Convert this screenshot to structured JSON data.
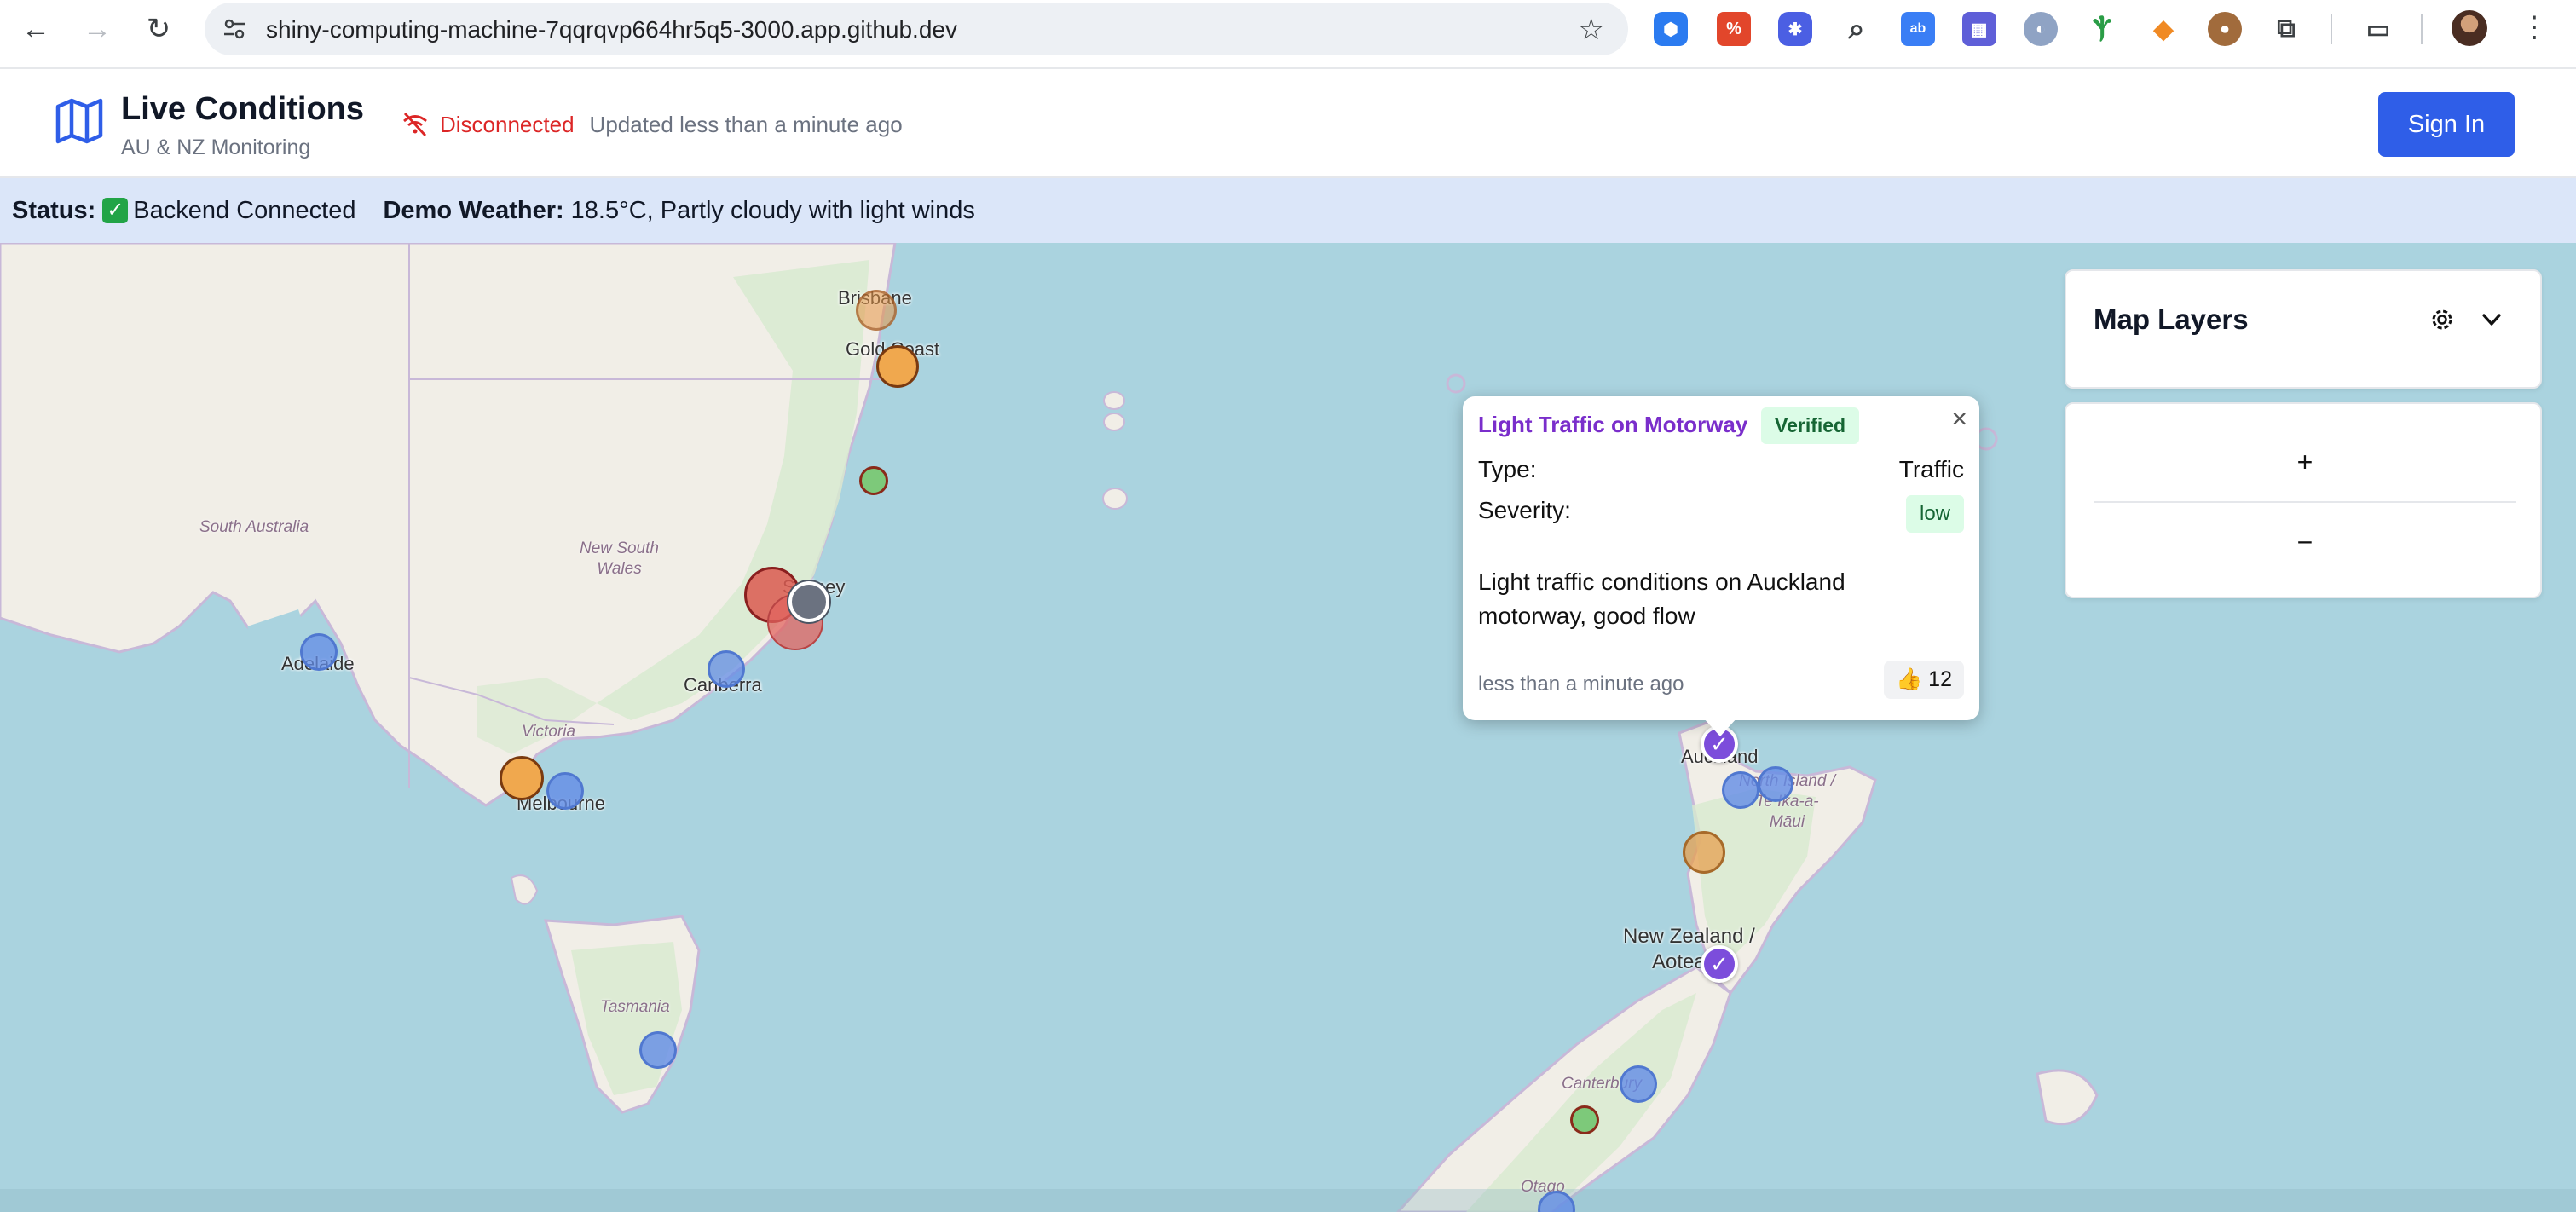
{
  "browser": {
    "url": "shiny-computing-machine-7qqrqvp664hr5q5-3000.app.github.dev"
  },
  "header": {
    "title": "Live Conditions",
    "subtitle": "AU & NZ Monitoring",
    "connection": "Disconnected",
    "updated": "Updated less than a minute ago",
    "sign_in": "Sign In"
  },
  "statusbar": {
    "status_label": "Status:",
    "status_value": "Backend Connected",
    "weather_label": "Demo Weather:",
    "weather_value": "18.5°C, Partly cloudy with light winds"
  },
  "map": {
    "places": [
      "Brisbane",
      "Gold Coast",
      "Sydney",
      "Canberra",
      "Adelaide",
      "Melbourne",
      "Auckland",
      "New Zealand /",
      "Aotearoa",
      "Otago"
    ],
    "regions": {
      "south_australia": "South Australia",
      "new_south_wales": "New South\nWales",
      "victoria": "Victoria",
      "tasmania": "Tasmania",
      "north_island": "North Island /\nTe Ika-a-\nMāui",
      "canterbury": "Canterbury",
      "otago": "Otago"
    }
  },
  "popup": {
    "title": "Light Traffic on Motorway",
    "badge": "Verified",
    "type_label": "Type:",
    "type_value": "Traffic",
    "severity_label": "Severity:",
    "severity_value": "low",
    "description": "Light traffic conditions on Auckland motorway, good flow",
    "time": "less than a minute ago",
    "votes": "👍 12"
  },
  "layers": {
    "title": "Map Layers",
    "zoom_in": "+",
    "zoom_out": "−"
  },
  "colors": {
    "accent": "#2f5ee8",
    "disconnected": "#dc2626",
    "verified": "#7c4ddb",
    "status_bar": "#dbe6f9"
  }
}
